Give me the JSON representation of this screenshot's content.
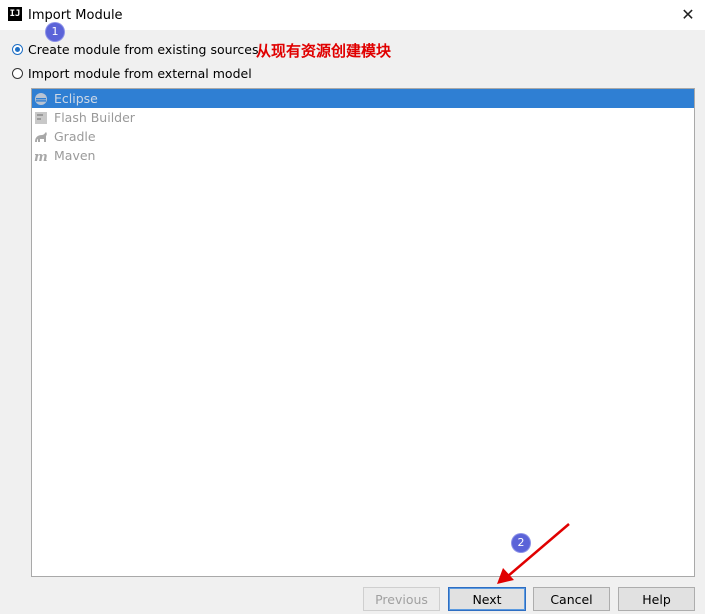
{
  "window": {
    "title": "Import Module",
    "icon_text": "IJ",
    "close_glyph": "✕"
  },
  "options": [
    {
      "label": "Create module from existing sources",
      "checked": true
    },
    {
      "label": "Import module from external model",
      "checked": false
    }
  ],
  "annotation_text": "从现有资源创建模块",
  "badges": [
    "1",
    "2"
  ],
  "models": [
    {
      "label": "Eclipse",
      "icon": "eclipse-icon",
      "selected": true
    },
    {
      "label": "Flash Builder",
      "icon": "flash-builder-icon",
      "selected": false
    },
    {
      "label": "Gradle",
      "icon": "gradle-icon",
      "selected": false
    },
    {
      "label": "Maven",
      "icon": "maven-icon",
      "selected": false
    }
  ],
  "buttons": {
    "previous": "Previous",
    "next": "Next",
    "cancel": "Cancel",
    "help": "Help"
  },
  "colors": {
    "annotation": "#e00000",
    "selection": "#2f7fd3",
    "badge": "#5b63d8",
    "arrow": "#e00000"
  }
}
